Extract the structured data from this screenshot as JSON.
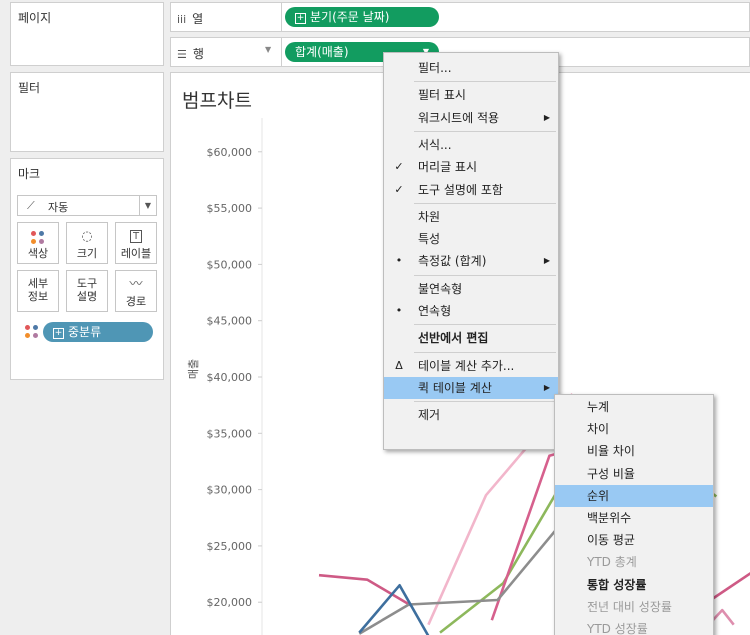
{
  "cards": {
    "pages_title": "페이지",
    "filters_title": "필터",
    "marks_title": "마크"
  },
  "marks": {
    "type_label": "자동",
    "buttons": {
      "color": "색상",
      "size": "크기",
      "label": "레이블",
      "detail": "세부\n정보",
      "tooltip": "도구\n설명",
      "path": "경로"
    },
    "field_pill": "중분류",
    "field_pill_color": "#4f96b5"
  },
  "shelves": {
    "columns_label": "열",
    "rows_label": "행",
    "columns_pill": "분기(주문 날짜)",
    "rows_pill": "합계(매출)",
    "pill_color": "#129c60"
  },
  "viz": {
    "title": "범프차트",
    "ylabel": "매출"
  },
  "chart_data": {
    "type": "line",
    "title": "범프차트",
    "ylabel": "매출",
    "ylim": [
      17000,
      63000
    ],
    "y_ticks": [
      {
        "value": 60000,
        "label": "$60,000"
      },
      {
        "value": 55000,
        "label": "$55,000"
      },
      {
        "value": 50000,
        "label": "$50,000"
      },
      {
        "value": 45000,
        "label": "$45,000"
      },
      {
        "value": 40000,
        "label": "$40,000"
      },
      {
        "value": 35000,
        "label": "$35,000"
      },
      {
        "value": 30000,
        "label": "$30,000"
      },
      {
        "value": 25000,
        "label": "$25,000"
      },
      {
        "value": 20000,
        "label": "$20,000"
      }
    ],
    "series": [
      {
        "color": "#ce5a85",
        "points": [
          [
            0.0,
            22400
          ],
          [
            0.42,
            22000
          ],
          [
            0.8,
            19700
          ]
        ]
      },
      {
        "color": "#f2b6cb",
        "points": [
          [
            0.95,
            18000
          ],
          [
            1.45,
            29500
          ],
          [
            2.2,
            38500
          ]
        ]
      },
      {
        "color": "#8db85c",
        "points": [
          [
            1.05,
            17300
          ],
          [
            1.6,
            21700
          ],
          [
            2.45,
            36500
          ],
          [
            2.6,
            35600
          ],
          [
            3.45,
            29400
          ]
        ]
      },
      {
        "color": "#d6608d",
        "points": [
          [
            1.5,
            18400
          ],
          [
            2.0,
            33000
          ],
          [
            2.6,
            34700
          ],
          [
            3.4,
            20200
          ]
        ]
      },
      {
        "color": "#8d8d8d",
        "points": [
          [
            0.35,
            17200
          ],
          [
            0.78,
            19800
          ],
          [
            1.55,
            20200
          ],
          [
            2.55,
            32500
          ]
        ]
      },
      {
        "color": "#3e6f9e",
        "points": [
          [
            0.35,
            17300
          ],
          [
            0.7,
            21500
          ],
          [
            0.95,
            17000
          ]
        ]
      },
      {
        "color": "#3e6f9e",
        "points": [
          [
            2.1,
            17300
          ],
          [
            2.45,
            20200
          ]
        ]
      },
      {
        "color": "#de8eae",
        "points": [
          [
            3.3,
            17100
          ],
          [
            3.5,
            19300
          ],
          [
            3.6,
            18000
          ]
        ]
      },
      {
        "color": "#ce5a85",
        "points": [
          [
            3.4,
            20200
          ],
          [
            3.75,
            22600
          ]
        ]
      }
    ]
  },
  "context_menu": {
    "items": [
      {
        "label": "필터...",
        "check": "",
        "arrow": false
      },
      {
        "sep": true
      },
      {
        "label": "필터 표시",
        "check": "",
        "arrow": false
      },
      {
        "label": "워크시트에 적용",
        "check": "",
        "arrow": true
      },
      {
        "sep": true
      },
      {
        "label": "서식...",
        "check": "",
        "arrow": false
      },
      {
        "label": "머리글 표시",
        "check": "✓",
        "arrow": false
      },
      {
        "label": "도구 설명에 포함",
        "check": "✓",
        "arrow": false
      },
      {
        "sep": true
      },
      {
        "label": "차원",
        "check": "",
        "arrow": false
      },
      {
        "label": "특성",
        "check": "",
        "arrow": false
      },
      {
        "label": "측정값 (합계)",
        "check": "•",
        "arrow": true
      },
      {
        "sep": true
      },
      {
        "label": "불연속형",
        "check": "",
        "arrow": false
      },
      {
        "label": "연속형",
        "check": "•",
        "arrow": false
      },
      {
        "sep": true
      },
      {
        "label": "선반에서 편집",
        "check": "",
        "arrow": false,
        "bold": true
      },
      {
        "sep": true
      },
      {
        "label": "테이블 계산 추가...",
        "check": "Δ",
        "arrow": false
      },
      {
        "label": "퀵 테이블 계산",
        "check": "",
        "arrow": true,
        "highlight": true
      },
      {
        "sep": true
      },
      {
        "label": "제거",
        "check": "",
        "arrow": false
      }
    ]
  },
  "submenu": {
    "items": [
      {
        "label": "누계"
      },
      {
        "label": "차이"
      },
      {
        "label": "비율 차이"
      },
      {
        "label": "구성 비율"
      },
      {
        "label": "순위",
        "highlight": true
      },
      {
        "label": "백분위수"
      },
      {
        "label": "이동 평균"
      },
      {
        "label": "YTD 총계",
        "disabled": true
      },
      {
        "label": "통합 성장률",
        "bold": true
      },
      {
        "label": "전년 대비 성장률",
        "disabled": true
      },
      {
        "label": "YTD 성장률",
        "disabled": true
      }
    ]
  }
}
